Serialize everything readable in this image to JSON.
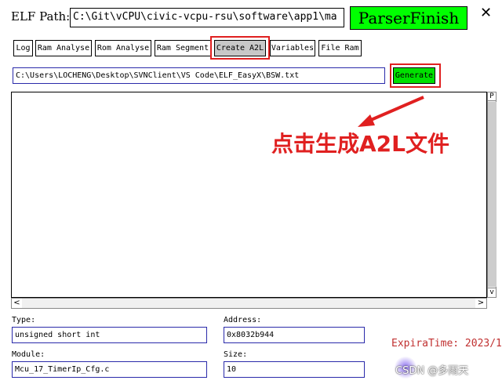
{
  "header": {
    "elf_label": "ELF Path:",
    "elf_path": "C:\\Git\\vCPU\\civic-vcpu-rsu\\software\\app1\\ma",
    "status": "ParserFinish",
    "close": "✕"
  },
  "tabs": [
    {
      "label": "Log"
    },
    {
      "label": "Ram Analyse"
    },
    {
      "label": "Rom Analyse"
    },
    {
      "label": "Ram Segment"
    },
    {
      "label": "Create A2L"
    },
    {
      "label": "Variables"
    },
    {
      "label": "File Ram"
    }
  ],
  "generate": {
    "file_path": "C:\\Users\\LOCHENG\\Desktop\\SVNClient\\VS Code\\ELF_EasyX\\BSW.txt",
    "button_label": "Generate"
  },
  "annotation": "点击生成A2L文件",
  "scroll": {
    "up": "P",
    "down": "v",
    "left": "<",
    "right": ">"
  },
  "fields": {
    "type_label": "Type:",
    "type_value": "unsigned short int",
    "address_label": "Address:",
    "address_value": "0x8032b944",
    "module_label": "Module:",
    "module_value": "Mcu_17_TimerIp_Cfg.c",
    "size_label": "Size:",
    "size_value": "10"
  },
  "footer": {
    "expira": "ExpiraTime: 2023/1",
    "watermark": "CSDN @多雨天"
  },
  "colors": {
    "status_bg": "#00ff00",
    "generate_bg": "#00e000",
    "highlight": "#e02020",
    "field_border": "#2a2aaa"
  }
}
